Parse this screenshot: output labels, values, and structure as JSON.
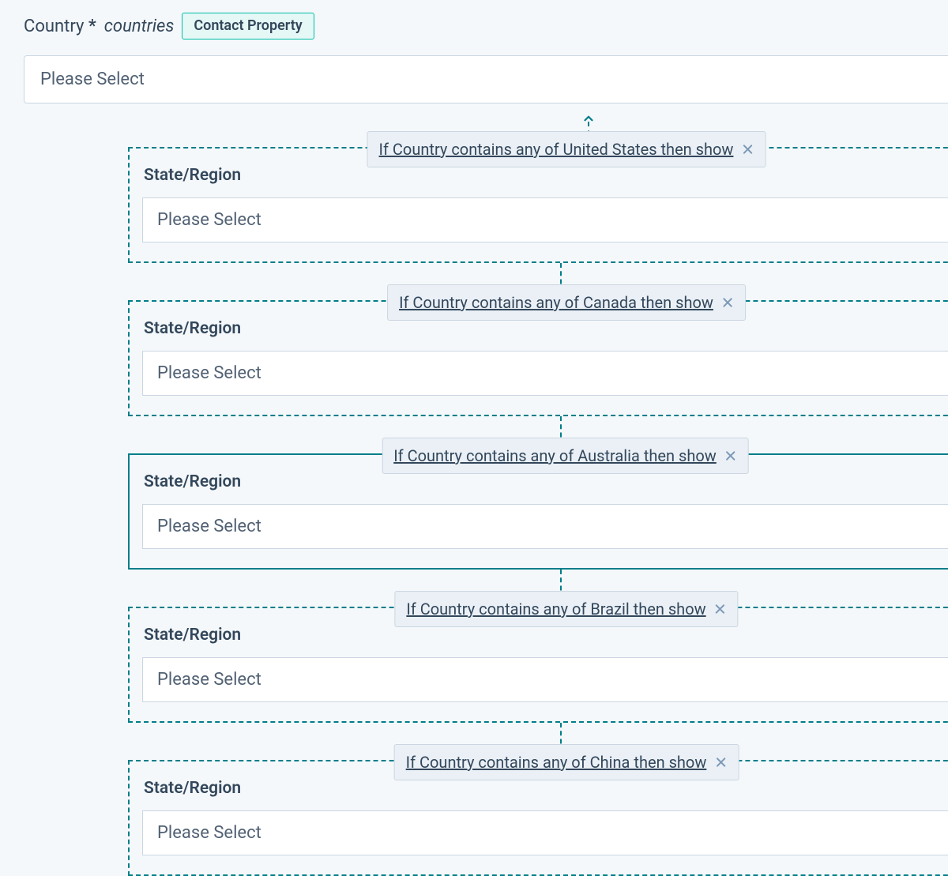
{
  "field": {
    "label": "Country",
    "required_marker": "*",
    "internal_name": "countries",
    "chip": "Contact Property",
    "placeholder": "Please Select"
  },
  "dependents": [
    {
      "rule": "If Country contains any of United States then show",
      "label": "State/Region",
      "placeholder": "Please Select",
      "active": false
    },
    {
      "rule": "If Country contains any of Canada then show",
      "label": "State/Region",
      "placeholder": "Please Select",
      "active": false
    },
    {
      "rule": "If Country contains any of Australia then show",
      "label": "State/Region",
      "placeholder": "Please Select",
      "active": true
    },
    {
      "rule": "If Country contains any of Brazil then show",
      "label": "State/Region",
      "placeholder": "Please Select",
      "active": false
    },
    {
      "rule": "If Country contains any of China then show",
      "label": "State/Region",
      "placeholder": "Please Select",
      "active": false
    }
  ]
}
